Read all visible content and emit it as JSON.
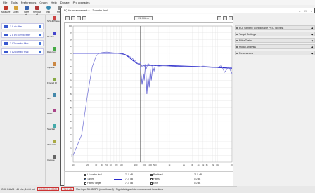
{
  "menubar": {
    "items": [
      "File",
      "Tools",
      "Preferences",
      "Graph",
      "Help",
      "Donate",
      "Pro upgrades"
    ]
  },
  "toolbar": {
    "buttons": [
      "Measure",
      "Open",
      "Save all",
      "Remove all",
      "Info",
      "Prefs"
    ]
  },
  "right_strip": {
    "labels": [
      "SPL & Phase",
      "All SPL",
      "Distortion",
      "Impulse",
      "Filtered IR",
      "GD",
      "RT60",
      "Spectral",
      "Waterfall",
      "Capture"
    ]
  },
  "measurements": {
    "items": [
      {
        "label": "1 L ch filter"
      },
      {
        "label": "2 L ch combo filter"
      },
      {
        "label": "3 L2 combo filter"
      },
      {
        "label": "4 L2 combo final"
      }
    ]
  },
  "eq_window": {
    "title": "EQ for measurement 4: L2 combo final",
    "eq_filters_button": "EQ Filters",
    "window_controls": [
      "–",
      "□",
      "×"
    ],
    "panel_headers": [
      "EQ: Generic Configurable PEQ (all bits)",
      "Target Settings",
      "Filter Tasks",
      "Modal Analysis",
      "Resonances"
    ]
  },
  "legend": {
    "col1": [
      "L2 combo final",
      "Target",
      "Filters+Target"
    ],
    "col1_checks": [
      true,
      true,
      false
    ],
    "col2": [
      "71.5 dB",
      "71.5 dB",
      "71.5 dB"
    ],
    "col3": [
      "Predicted",
      "Filters",
      "Error"
    ],
    "col4": [
      "71.5 dB",
      "0.0 dB",
      "0.0 dB"
    ]
  },
  "status": {
    "left": "OSC DUMB",
    "meter_label": "46 kHz, 16-bit out",
    "readout_1": "0.00000 0.00000",
    "readout_2": "71.5 dB",
    "memory": "Max input 0B.8B SPL (uncalibrated)",
    "hint": "Right click graph to measurement for actions"
  },
  "chart_data": {
    "type": "line",
    "xscale": "log",
    "xlim": [
      10,
      20000
    ],
    "x_ticks": [
      "10",
      "20",
      "30",
      "40",
      "50",
      "60",
      "80",
      "100",
      "200",
      "300",
      "400",
      "500",
      "1k",
      "2k",
      "3k",
      "4k",
      "5k",
      "6k",
      "8k",
      "10k",
      "20k"
    ],
    "ylim": [
      0,
      100
    ],
    "y_ticks": [
      "100",
      "95",
      "90",
      "85",
      "80",
      "75",
      "70",
      "65",
      "60",
      "55",
      "50",
      "45",
      "40",
      "35",
      "30",
      "25",
      "20",
      "15",
      "10",
      "5"
    ],
    "cursor_x": 250,
    "series": [
      {
        "name": "Target",
        "color": "#2a2acc",
        "x": [
          10,
          20,
          40,
          60,
          80,
          100,
          120,
          140,
          170,
          200,
          250,
          300,
          500,
          1000,
          2000,
          5000,
          10000,
          20000
        ],
        "y": [
          80,
          80,
          80,
          80,
          80,
          79.8,
          79,
          77.5,
          75,
          73,
          71.4,
          71.2,
          71,
          70.8,
          70.5,
          70,
          69.5,
          69
        ]
      },
      {
        "name": "L2 combo final",
        "color": "#7b7bd8",
        "x": [
          10,
          15,
          20,
          25,
          30,
          35,
          40,
          50,
          60,
          80,
          100,
          130,
          160,
          200,
          230,
          250,
          270,
          300,
          330,
          360,
          400,
          450,
          500,
          600,
          800,
          1000,
          1500,
          2000,
          3000,
          4000,
          5000,
          7000,
          10000,
          12000,
          14000,
          17000,
          20000
        ],
        "y": [
          5,
          20,
          50,
          70,
          78,
          80,
          80.5,
          80.8,
          80.5,
          80,
          79.5,
          78.5,
          77,
          74,
          71.5,
          73,
          70,
          71,
          68.5,
          72.5,
          71,
          70.5,
          71.5,
          70.5,
          71,
          70.5,
          70,
          70.3,
          70,
          69.8,
          70.5,
          70,
          69.5,
          71,
          66,
          70,
          65
        ]
      },
      {
        "name": "Filters",
        "color": "#5a5ad0",
        "x": [
          250,
          270,
          290,
          300,
          320,
          340,
          360,
          380,
          400,
          420,
          450,
          480,
          500
        ],
        "y": [
          70,
          57,
          65,
          60,
          72,
          50,
          63,
          55,
          68,
          60,
          70,
          67,
          70
        ]
      }
    ]
  }
}
